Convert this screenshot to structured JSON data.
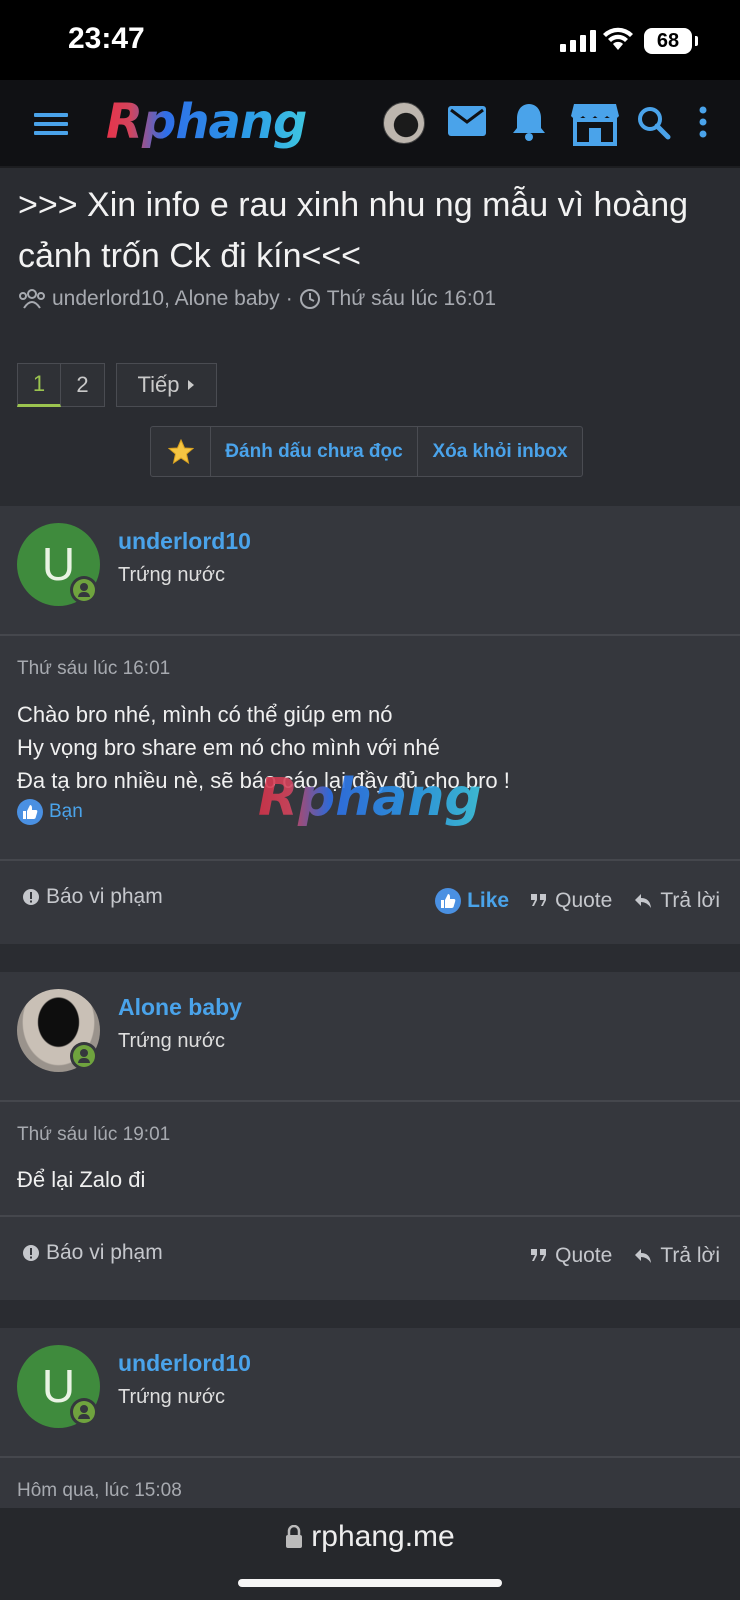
{
  "status": {
    "time": "23:47",
    "battery": "68"
  },
  "nav": {
    "logo": "Rphang"
  },
  "thread": {
    "title": ">>> Xin info e rau xinh nhu ng mẫu vì hoàng cảnh trốn Ck đi kín<<<",
    "participants": "underlord10, Alone baby",
    "separator": "·",
    "time": "Thứ sáu lúc 16:01"
  },
  "pager": {
    "current": "1",
    "page2": "2",
    "next": "Tiếp"
  },
  "actions": {
    "mark_unread": "Đánh dấu chưa đọc",
    "remove_inbox": "Xóa khỏi inbox"
  },
  "posts": [
    {
      "avatar_letter": "U",
      "username": "underlord10",
      "user_title": "Trứng nước",
      "time": "Thứ sáu lúc 16:01",
      "lines": [
        "Chào bro nhé, mình có thể giúp em nó",
        "Hy vọng bro share em nó cho mình với nhé",
        "Đa tạ bro nhiều nè, sẽ báo cáo lại đầy đủ cho bro !"
      ],
      "reaction": "Bạn",
      "report": "Báo vi phạm",
      "like": "Like",
      "quote": "Quote",
      "reply": "Trả lời"
    },
    {
      "avatar_letter": "",
      "username": "Alone baby",
      "user_title": "Trứng nước",
      "time": "Thứ sáu lúc 19:01",
      "lines": [
        "Để lại Zalo đi"
      ],
      "report": "Báo vi phạm",
      "quote": "Quote",
      "reply": "Trả lời"
    },
    {
      "avatar_letter": "U",
      "username": "underlord10",
      "user_title": "Trứng nước",
      "time": "Hôm qua, lúc 15:08"
    }
  ],
  "watermark": "Rphang",
  "url": "rphang.me",
  "colors": {
    "accent": "#4aa3ea",
    "online": "#6fa33e",
    "avatar_bg": "#3f8b3d"
  }
}
